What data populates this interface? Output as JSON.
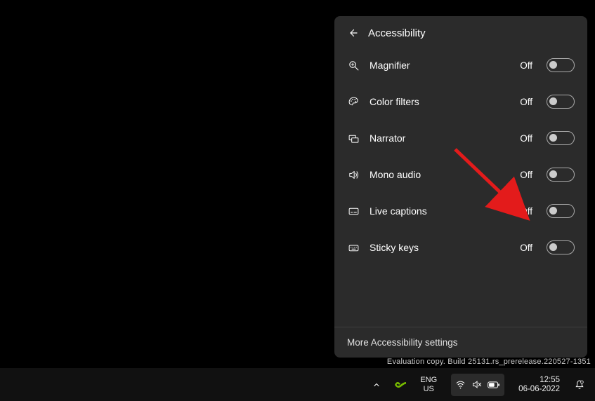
{
  "panel": {
    "title": "Accessibility",
    "rows": [
      {
        "label": "Magnifier",
        "state": "Off"
      },
      {
        "label": "Color filters",
        "state": "Off"
      },
      {
        "label": "Narrator",
        "state": "Off"
      },
      {
        "label": "Mono audio",
        "state": "Off"
      },
      {
        "label": "Live captions",
        "state": "Off"
      },
      {
        "label": "Sticky keys",
        "state": "Off"
      }
    ],
    "footer_link": "More Accessibility settings"
  },
  "watermark": "Evaluation copy. Build 25131.rs_prerelease.220527-1351",
  "taskbar": {
    "lang_top": "ENG",
    "lang_bottom": "US",
    "time": "12:55",
    "date": "06-06-2022"
  }
}
